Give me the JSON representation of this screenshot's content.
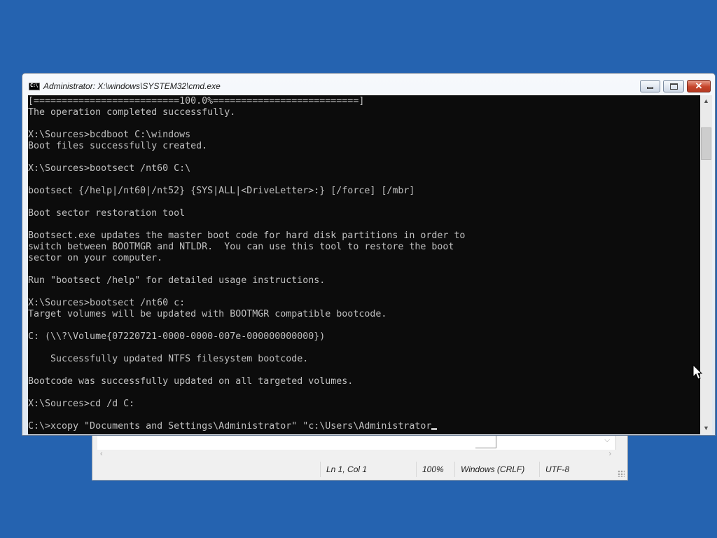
{
  "notepad": {
    "status": {
      "position": "Ln 1, Col 1",
      "zoom": "100%",
      "line_ending": "Windows (CRLF)",
      "encoding": "UTF-8"
    }
  },
  "cmd": {
    "title": "Administrator: X:\\windows\\SYSTEM32\\cmd.exe",
    "icon_label": "C:\\",
    "controls": {
      "minimize": "minimize-icon",
      "maximize": "maximize-icon",
      "close": "✕"
    },
    "lines": [
      "[==========================100.0%==========================]",
      "The operation completed successfully.",
      "",
      "X:\\Sources>bcdboot C:\\windows",
      "Boot files successfully created.",
      "",
      "X:\\Sources>bootsect /nt60 C:\\",
      "",
      "bootsect {/help|/nt60|/nt52} {SYS|ALL|<DriveLetter>:} [/force] [/mbr]",
      "",
      "Boot sector restoration tool",
      "",
      "Bootsect.exe updates the master boot code for hard disk partitions in order to",
      "switch between BOOTMGR and NTLDR.  You can use this tool to restore the boot",
      "sector on your computer.",
      "",
      "Run \"bootsect /help\" for detailed usage instructions.",
      "",
      "X:\\Sources>bootsect /nt60 c:",
      "Target volumes will be updated with BOOTMGR compatible bootcode.",
      "",
      "C: (\\\\?\\Volume{07220721-0000-0000-007e-000000000000})",
      "",
      "    Successfully updated NTFS filesystem bootcode.",
      "",
      "Bootcode was successfully updated on all targeted volumes.",
      "",
      "X:\\Sources>cd /d C:",
      ""
    ],
    "current_input": "C:\\>xcopy \"Documents and Settings\\Administrator\" \"c:\\Users\\Administrator"
  },
  "colors": {
    "desktop": "#2563b0",
    "console_bg": "#0c0c0c",
    "console_fg": "#c0c0c0",
    "close_button": "#c6452b"
  }
}
